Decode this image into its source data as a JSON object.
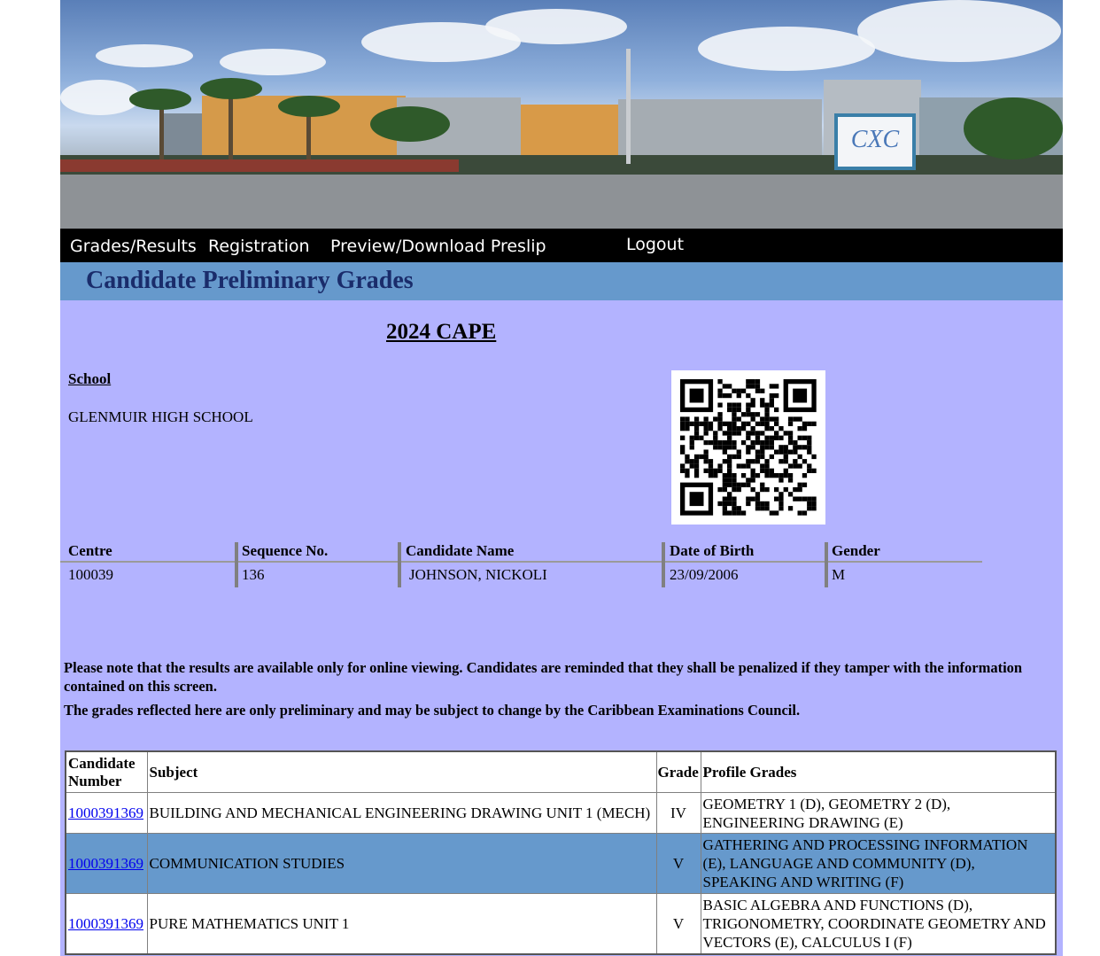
{
  "nav": {
    "grades_results": "Grades/Results",
    "registration": "Registration",
    "preview_download": "Preview/Download Preslip",
    "logout": "Logout"
  },
  "banner": {
    "sign_text": "CXC"
  },
  "page_title": "Candidate Preliminary Grades",
  "exam_title": "2024 CAPE",
  "school": {
    "label": "School",
    "name": "GLENMUIR HIGH SCHOOL"
  },
  "candidate_info": {
    "headers": {
      "centre": "Centre",
      "sequence": "Sequence No.",
      "name": "Candidate Name",
      "dob": "Date of Birth",
      "gender": "Gender"
    },
    "values": {
      "centre": "100039",
      "sequence": "136",
      "name": "JOHNSON, NICKOLI",
      "dob": "23/09/2006",
      "gender": "M"
    }
  },
  "notices": [
    "Please note that the results are available only for online viewing. Candidates are reminded that they shall be penalized if they tamper with the information contained on this screen.",
    "The grades reflected here are only preliminary and may be subject to change by the Caribbean Examinations Council."
  ],
  "grades_table": {
    "headers": {
      "candidate_number": "Candidate Number",
      "subject": "Subject",
      "grade": "Grade",
      "profile_grades": "Profile Grades"
    },
    "rows": [
      {
        "candidate_number": "1000391369",
        "subject": "BUILDING AND MECHANICAL ENGINEERING DRAWING UNIT 1 (MECH)",
        "grade": "IV",
        "profile_grades": "GEOMETRY 1 (D), GEOMETRY 2 (D), ENGINEERING DRAWING (E)"
      },
      {
        "candidate_number": "1000391369",
        "subject": "COMMUNICATION STUDIES",
        "grade": "V",
        "profile_grades": "GATHERING AND PROCESSING INFORMATION (E), LANGUAGE AND COMMUNITY (D), SPEAKING AND WRITING (F)"
      },
      {
        "candidate_number": "1000391369",
        "subject": "PURE MATHEMATICS UNIT 1",
        "grade": "V",
        "profile_grades": "BASIC ALGEBRA AND FUNCTIONS (D), TRIGONOMETRY, COORDINATE GEOMETRY AND VECTORS (E), CALCULUS I (F)"
      }
    ]
  }
}
